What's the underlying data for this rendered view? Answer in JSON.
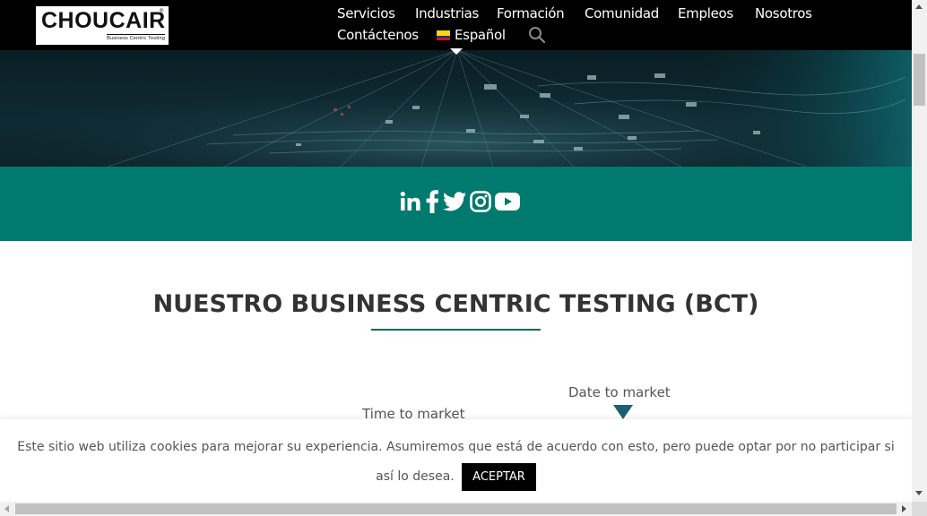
{
  "header": {
    "logo_text": "CHOUCAIR",
    "logo_reg": "®",
    "logo_tagline": "Business Centric Testing",
    "nav": [
      {
        "label": "Servicios"
      },
      {
        "label": "Industrias"
      },
      {
        "label": "Formación"
      },
      {
        "label": "Comunidad"
      },
      {
        "label": "Empleos"
      },
      {
        "label": "Nosotros"
      },
      {
        "label": "Contáctenos"
      }
    ],
    "language": "Español",
    "search_icon": "search-icon",
    "flag_colors": [
      "#fcd116",
      "#003893",
      "#ce1126"
    ]
  },
  "social": {
    "background": "#00796e",
    "icons": [
      "linkedin-icon",
      "facebook-icon",
      "twitter-icon",
      "instagram-icon",
      "youtube-icon"
    ]
  },
  "main": {
    "section_title": "NUESTRO BUSINESS CENTRIC TESTING (BCT)",
    "graphic": {
      "label_time": "Time to market",
      "label_date": "Date to market"
    }
  },
  "cookie": {
    "message_part1": "Este sitio web utiliza cookies para mejorar su experiencia. Asumiremos que está de acuerdo con esto, pero puede optar por no participar si así lo",
    "message_part2": "desea.",
    "accept_label": "ACEPTAR"
  },
  "colors": {
    "header_bg": "#000000",
    "accent": "#00796e",
    "title_rule": "#00695c",
    "arrow": "#1f5f73"
  }
}
